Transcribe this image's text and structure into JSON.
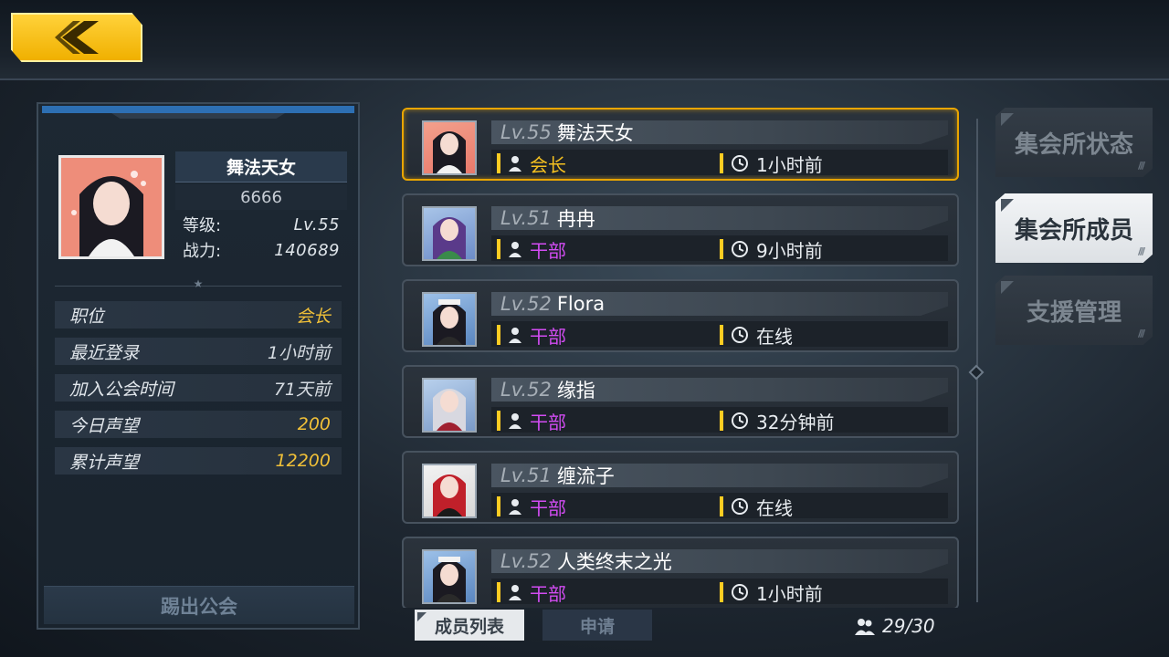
{
  "nav": {
    "back_icon": "chevron-left-icon"
  },
  "profile": {
    "name": "舞法天女",
    "id": "6666",
    "level_label": "等级:",
    "level_value": "Lv.55",
    "power_label": "战力:",
    "power_value": "140689",
    "info": [
      {
        "label": "职位",
        "value": "会长",
        "color": "#f0c038"
      },
      {
        "label": "最近登录",
        "value": "1小时前",
        "color": "#d6dce2"
      },
      {
        "label": "加入公会时间",
        "value": "71天前",
        "color": "#d6dce2"
      },
      {
        "label": "今日声望",
        "value": "200",
        "color": "#f0c038"
      },
      {
        "label": "累计声望",
        "value": "12200",
        "color": "#f0c038"
      }
    ],
    "kick_button": "踢出公会"
  },
  "members": [
    {
      "lv_label": "Lv.55",
      "name": "舞法天女",
      "role": "会长",
      "role_type": "leader",
      "last_seen": "1小时前",
      "selected": true
    },
    {
      "lv_label": "Lv.51",
      "name": "冉冉",
      "role": "干部",
      "role_type": "officer",
      "last_seen": "9小时前",
      "selected": false
    },
    {
      "lv_label": "Lv.52",
      "name": "Flora",
      "role": "干部",
      "role_type": "officer",
      "last_seen": "在线",
      "selected": false
    },
    {
      "lv_label": "Lv.52",
      "name": "缘指",
      "role": "干部",
      "role_type": "officer",
      "last_seen": "32分钟前",
      "selected": false
    },
    {
      "lv_label": "Lv.51",
      "name": "缠流子",
      "role": "干部",
      "role_type": "officer",
      "last_seen": "在线",
      "selected": false
    },
    {
      "lv_label": "Lv.52",
      "name": "人类终末之光",
      "role": "干部",
      "role_type": "officer",
      "last_seen": "1小时前",
      "selected": false
    }
  ],
  "side_tabs": [
    {
      "label": "集会所状态",
      "active": false
    },
    {
      "label": "集会所成员",
      "active": true
    },
    {
      "label": "支援管理",
      "active": false
    }
  ],
  "bottom_tabs": [
    {
      "label": "成员列表",
      "active": true
    },
    {
      "label": "申请",
      "active": false
    }
  ],
  "member_count": "29/30",
  "colors": {
    "accent_gold": "#f0c038",
    "officer_purple": "#d24cf2",
    "back_yellow": "#ffd23a"
  }
}
